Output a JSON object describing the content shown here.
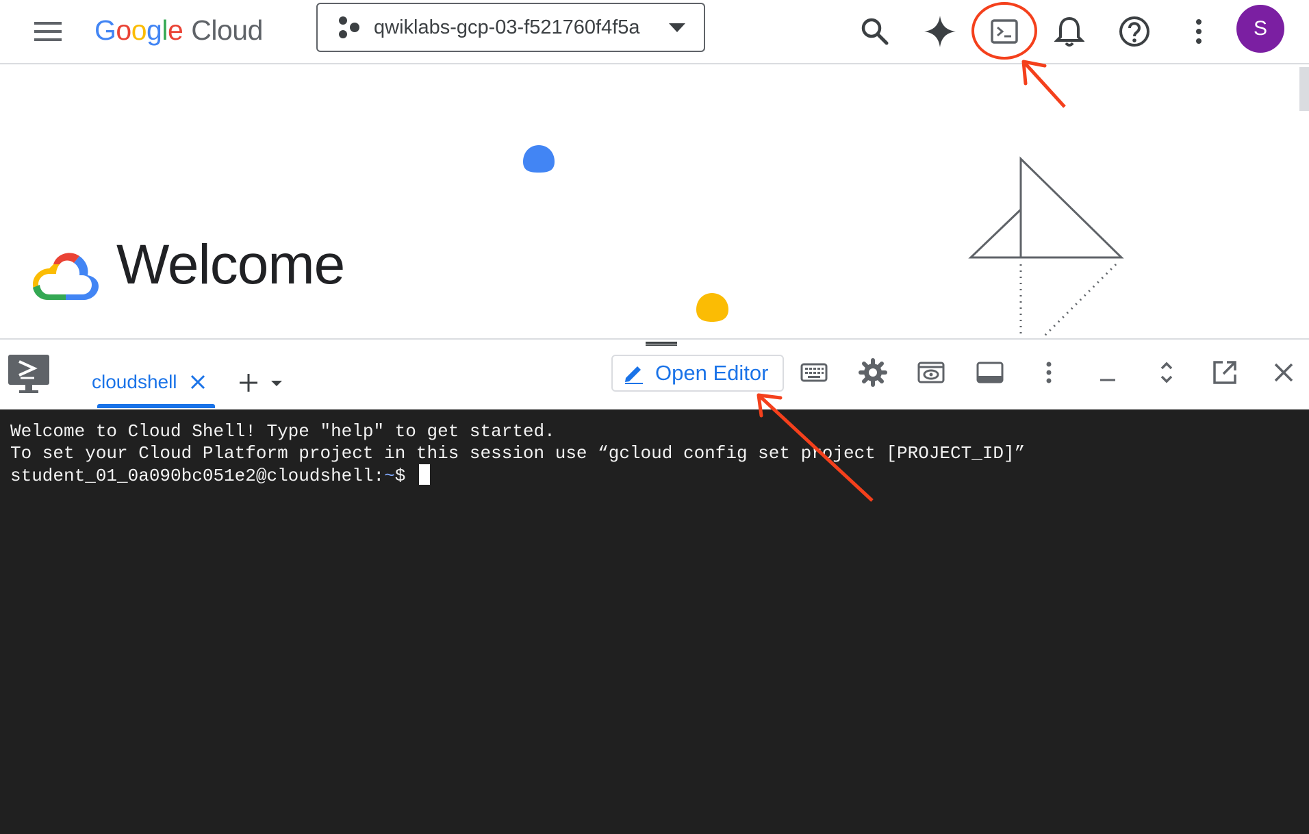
{
  "header": {
    "logo": {
      "google_letters": [
        "G",
        "o",
        "o",
        "g",
        "l",
        "e"
      ],
      "cloud": "Cloud"
    },
    "project_picker": {
      "name": "qwiklabs-gcp-03-f521760f4f5a"
    },
    "icons": [
      "menu-icon",
      "search-icon",
      "gemini-spark-icon",
      "cloud-shell-terminal-icon",
      "notifications-bell-icon",
      "help-icon",
      "more-vert-icon"
    ],
    "avatar_letter": "S",
    "avatar_color": "#7b1fa2"
  },
  "welcome": {
    "title": "Welcome"
  },
  "cloudshell": {
    "tab_label": "cloudshell",
    "open_editor_label": "Open Editor",
    "toolbar_icons": [
      "keyboard-icon",
      "settings-icon",
      "web-preview-icon",
      "panel-layout-icon",
      "more-vert-icon",
      "minimize-icon",
      "expand-icon",
      "open-new-window-icon",
      "close-icon"
    ],
    "terminal": {
      "line1": "Welcome to Cloud Shell! Type \"help\" to get started.",
      "line2": "To set your Cloud Platform project in this session use “gcloud config set project [PROJECT_ID]”",
      "prompt_user": "student_01_0a090bc051e2@cloudshell:",
      "prompt_dir": "~",
      "prompt_symbol": "$ "
    }
  },
  "annotation_color": "#f4401c",
  "accent_color": "#1a73e8"
}
